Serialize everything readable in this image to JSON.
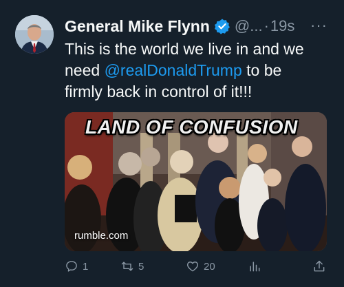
{
  "author": {
    "name": "General Mike Flynn",
    "handle": "@...",
    "separator": "·",
    "time": "19s",
    "more": "···"
  },
  "tweet": {
    "line1": "This is the world we live in and we",
    "line2_pre": "need ",
    "mention": "@realDonaldTrump",
    "line2_post": " to be",
    "line3": "firmly back in control of it!!!"
  },
  "media": {
    "title": "LAND OF CONFUSION",
    "source": "rumble.com"
  },
  "actions": {
    "replies": "1",
    "retweets": "5",
    "likes": "20"
  },
  "colors": {
    "background": "#15202b",
    "accent": "#1d9bf0",
    "muted": "#8b98a5",
    "text": "#f7f9f9"
  }
}
